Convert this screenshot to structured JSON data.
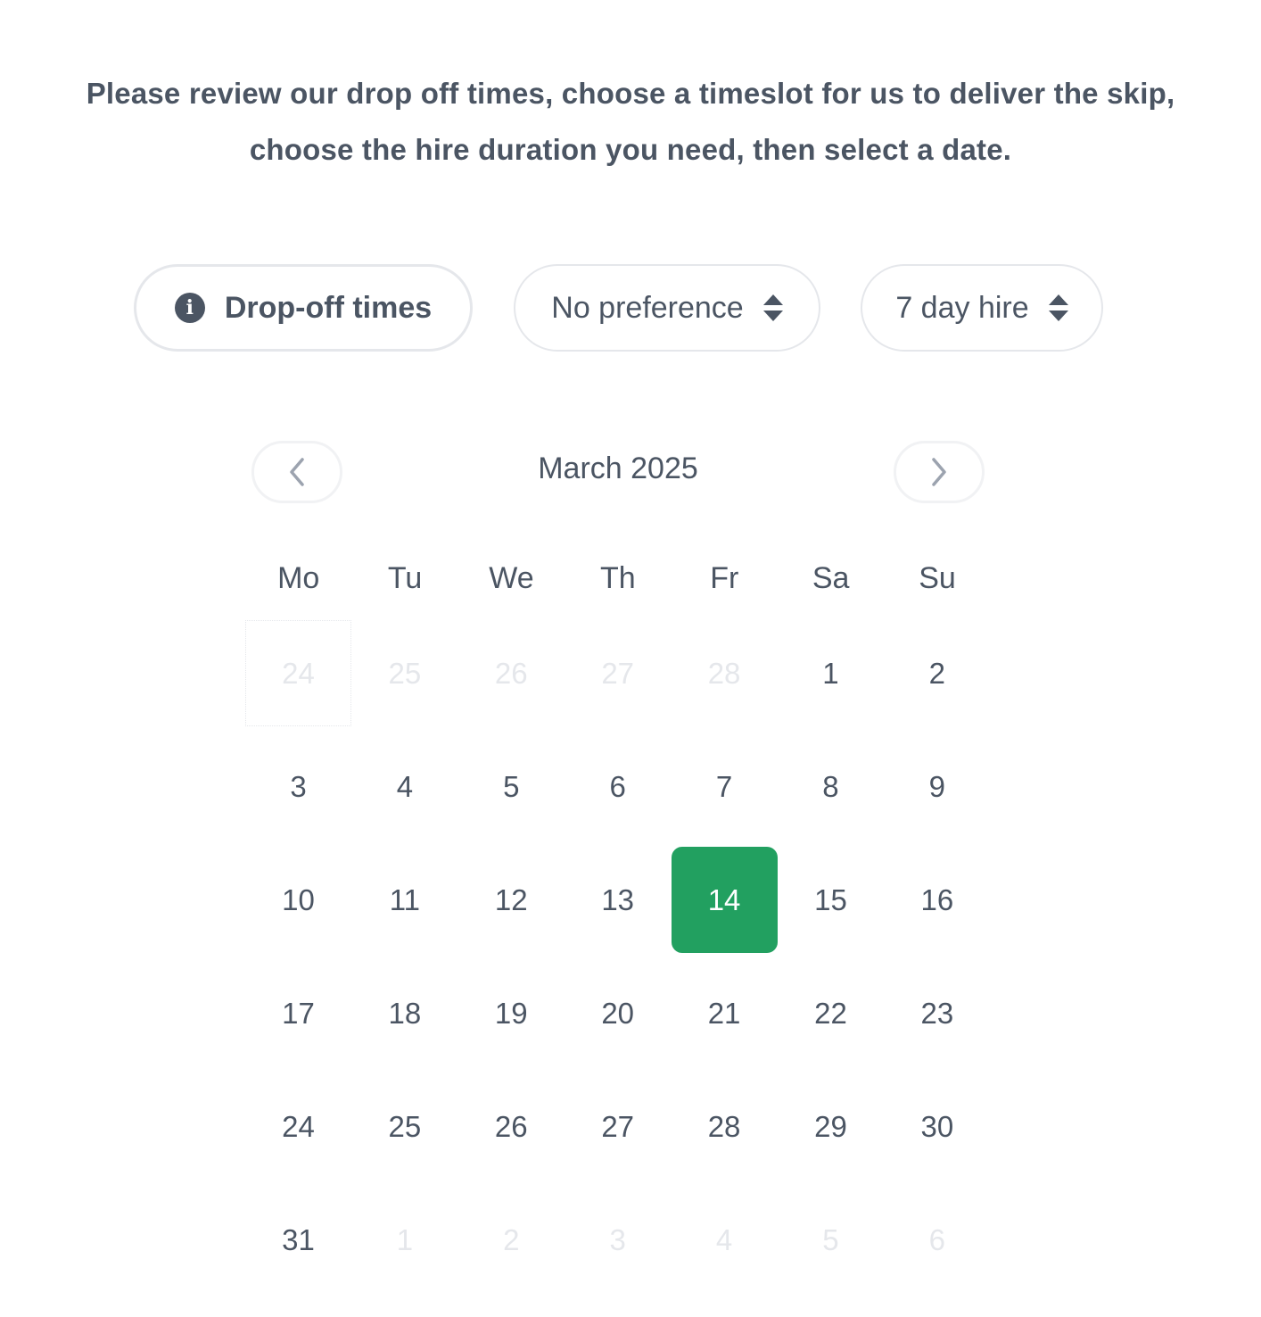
{
  "intro_text": "Please review our drop off times, choose a timeslot for us to deliver the skip, choose the hire duration you need, then select a date.",
  "controls": {
    "dropoff_button": {
      "label": "Drop-off times",
      "icon": "info-icon"
    },
    "timeslot_select": {
      "value": "No preference",
      "icon": "sort-icon"
    },
    "duration_select": {
      "value": "7 day hire",
      "icon": "sort-icon"
    }
  },
  "calendar": {
    "month_label": "March 2025",
    "prev_icon": "chevron-left-icon",
    "next_icon": "chevron-right-icon",
    "weekdays": [
      "Mo",
      "Tu",
      "We",
      "Th",
      "Fr",
      "Sa",
      "Su"
    ],
    "selected_day": "14",
    "accent_color": "#22a060",
    "weeks": [
      [
        {
          "day": "24",
          "muted": true,
          "focus": true
        },
        {
          "day": "25",
          "muted": true
        },
        {
          "day": "26",
          "muted": true
        },
        {
          "day": "27",
          "muted": true
        },
        {
          "day": "28",
          "muted": true
        },
        {
          "day": "1"
        },
        {
          "day": "2"
        }
      ],
      [
        {
          "day": "3"
        },
        {
          "day": "4"
        },
        {
          "day": "5"
        },
        {
          "day": "6"
        },
        {
          "day": "7"
        },
        {
          "day": "8"
        },
        {
          "day": "9"
        }
      ],
      [
        {
          "day": "10"
        },
        {
          "day": "11"
        },
        {
          "day": "12"
        },
        {
          "day": "13"
        },
        {
          "day": "14",
          "selected": true
        },
        {
          "day": "15"
        },
        {
          "day": "16"
        }
      ],
      [
        {
          "day": "17"
        },
        {
          "day": "18"
        },
        {
          "day": "19"
        },
        {
          "day": "20"
        },
        {
          "day": "21"
        },
        {
          "day": "22"
        },
        {
          "day": "23"
        }
      ],
      [
        {
          "day": "24"
        },
        {
          "day": "25"
        },
        {
          "day": "26"
        },
        {
          "day": "27"
        },
        {
          "day": "28"
        },
        {
          "day": "29"
        },
        {
          "day": "30"
        }
      ],
      [
        {
          "day": "31"
        },
        {
          "day": "1",
          "muted": true
        },
        {
          "day": "2",
          "muted": true
        },
        {
          "day": "3",
          "muted": true
        },
        {
          "day": "4",
          "muted": true
        },
        {
          "day": "5",
          "muted": true
        },
        {
          "day": "6",
          "muted": true
        }
      ]
    ]
  }
}
